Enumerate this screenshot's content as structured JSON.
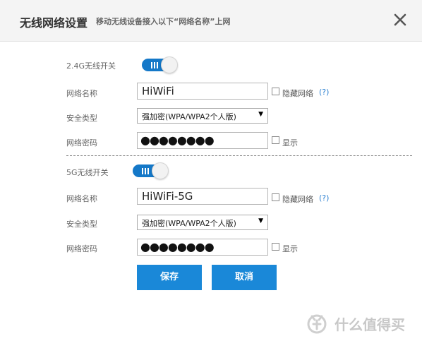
{
  "dialog": {
    "title": "无线网络设置",
    "subtitle": "移动无线设备接入以下“网络名称”上网"
  },
  "band_24g": {
    "switch_label": "2.4G无线开关",
    "switch_on": true,
    "ssid_label": "网络名称",
    "ssid_value": "HiWiFi",
    "hide_label": "隐藏网络",
    "help_label": "(?)",
    "security_label": "安全类型",
    "security_value": "强加密(WPA/WPA2个人版)",
    "password_label": "网络密码",
    "password_masked": "●●●●●●●●",
    "show_label": "显示"
  },
  "band_5g": {
    "switch_label": "5G无线开关",
    "switch_on": true,
    "ssid_label": "网络名称",
    "ssid_value": "HiWiFi-5G",
    "hide_label": "隐藏网络",
    "help_label": "(?)",
    "security_label": "安全类型",
    "security_value": "强加密(WPA/WPA2个人版)",
    "password_label": "网络密码",
    "password_masked": "●●●●●●●●",
    "show_label": "显示"
  },
  "buttons": {
    "save": "保存",
    "cancel": "取消"
  },
  "watermark": {
    "text": "什么值得买"
  },
  "colors": {
    "accent": "#1a88d8",
    "toggle": "#1478c8"
  }
}
